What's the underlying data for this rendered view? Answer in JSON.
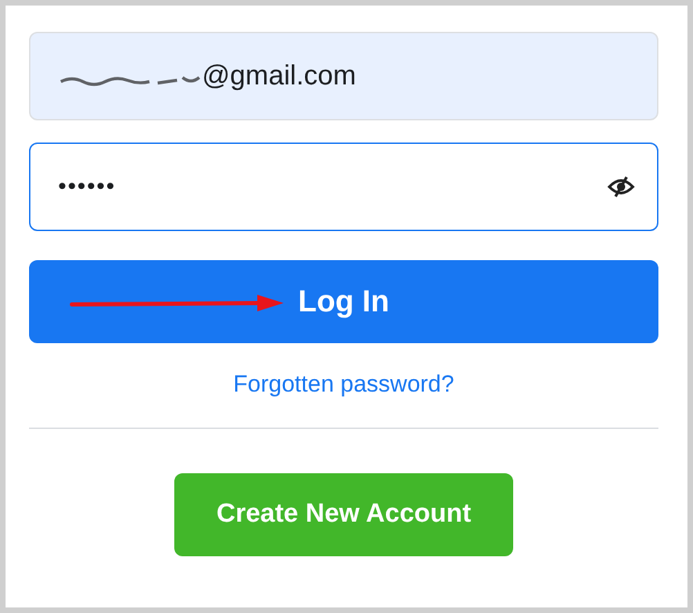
{
  "email_field": {
    "value": "@gmail.com",
    "autofilled": true,
    "focused": false
  },
  "password_field": {
    "value": "••••••",
    "autofilled": false,
    "focused": true
  },
  "login_button": {
    "label": "Log In"
  },
  "forgot_link": {
    "label": "Forgotten password?"
  },
  "create_button": {
    "label": "Create New Account"
  }
}
